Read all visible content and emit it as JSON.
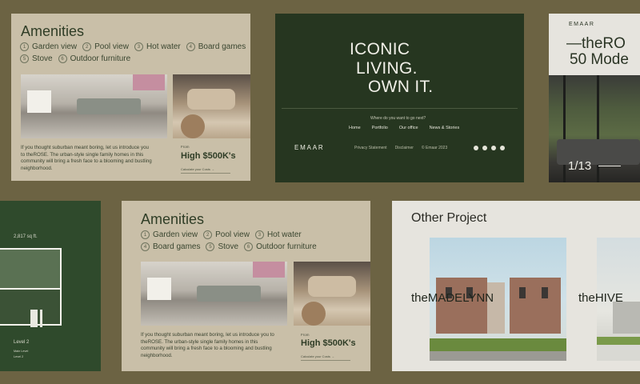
{
  "amenities_top": {
    "title": "Amenities",
    "chips": [
      {
        "num": "1",
        "label": "Garden view"
      },
      {
        "num": "2",
        "label": "Pool view"
      },
      {
        "num": "3",
        "label": "Hot water"
      },
      {
        "num": "4",
        "label": "Board games"
      },
      {
        "num": "5",
        "label": "Stove"
      },
      {
        "num": "6",
        "label": "Outdoor furniture"
      }
    ],
    "description": "If you thought suburban meant boring, let us introduce you to theROSE. The urban-style single family homes in this community will bring a fresh face to a blooming and bustling neighborhood.",
    "price_label": "From",
    "price": "High $500K's",
    "calc_link": "Calculate your Costs →"
  },
  "iconic": {
    "hero": [
      "ICONIC",
      "LIVING.",
      "OWN IT."
    ],
    "question": "Where do you want to go next?",
    "nav": [
      "Home",
      "Portfolio",
      "Our office",
      "News & Stories"
    ],
    "brand": "EMAAR",
    "footer_links": [
      "Privacy Statement",
      "Disclaimer",
      "© Emaar 2023"
    ],
    "socials": [
      "facebook-icon",
      "linkedin-icon",
      "instagram-icon",
      "twitter-icon"
    ]
  },
  "rose": {
    "brand": "EMAAR",
    "title_line1": "—theRO",
    "title_line2": "50 Mode",
    "counter": "1/13"
  },
  "plan": {
    "area": "2,817 sq ft.",
    "level": "Level 2",
    "sublevel1": "Main Level",
    "sublevel2": "Level 2"
  },
  "amenities_bottom": {
    "title": "Amenities",
    "chips": [
      {
        "num": "1",
        "label": "Garden view"
      },
      {
        "num": "2",
        "label": "Pool view"
      },
      {
        "num": "3",
        "label": "Hot water"
      },
      {
        "num": "4",
        "label": "Board games"
      },
      {
        "num": "5",
        "label": "Stove"
      },
      {
        "num": "6",
        "label": "Outdoor furniture"
      }
    ],
    "description": "If you thought suburban meant boring, let us introduce you to theROSE. The urban-style single family homes in this community will bring a fresh face to a blooming and bustling neighborhood.",
    "price_label": "From",
    "price": "High $500K's",
    "calc_link": "Calculate your Costs →"
  },
  "other": {
    "title": "Other Project",
    "projects": [
      "theMADELYNN",
      "theHIVE"
    ]
  },
  "colors": {
    "background": "#6c6343",
    "forest": "#263620",
    "sand": "#c9bfa8",
    "cream": "#e6e4de"
  }
}
